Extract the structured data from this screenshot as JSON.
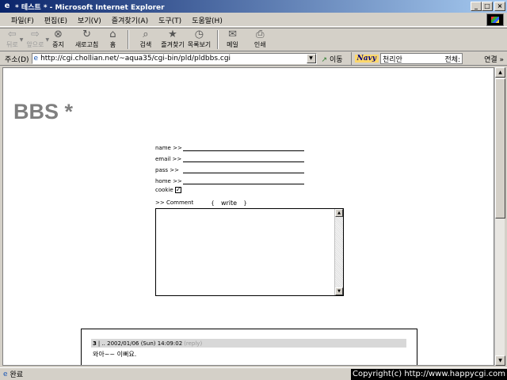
{
  "window": {
    "title": "* 테스트 * - Microsoft Internet Explorer",
    "min_label": "_",
    "max_label": "□",
    "close_label": "×"
  },
  "menu": {
    "items": [
      "파일(F)",
      "편집(E)",
      "보기(V)",
      "즐겨찾기(A)",
      "도구(T)",
      "도움말(H)"
    ]
  },
  "toolbar": {
    "back": "뒤로",
    "forward": "앞으로",
    "stop": "중지",
    "refresh": "새로고침",
    "home": "홈",
    "search": "검색",
    "favorites": "즐겨찾기",
    "history": "목록보기",
    "mail": "메일",
    "print": "인쇄"
  },
  "address": {
    "label": "주소(D)",
    "url": "http://cgi.chollian.net/~aqua35/cgi-bin/pld/pldbbs.cgi",
    "go_label": "이동",
    "navy_label": "Navy",
    "navy_query": "천리안",
    "navy_scope": "전체:",
    "links_label": "연결 »"
  },
  "page": {
    "title": "BBS *",
    "form": {
      "name_label": "name >>",
      "email_label": "email >>",
      "pass_label": "pass >>",
      "home_label": "home >>",
      "cookie_label": "cookie",
      "cookie_checked": true,
      "comment_label": ">> Comment",
      "write_label": "write",
      "bracket_open": "{",
      "bracket_close": "}"
    },
    "post": {
      "number": "3",
      "meta": "| .. 2002/01/06 (Sun) 14:09:02",
      "reply_label": "(reply)",
      "body": "와아~~ 이뻐요."
    }
  },
  "status": {
    "text": "완료",
    "copyright": "Copyright(c) http://www.happycgi.com"
  }
}
